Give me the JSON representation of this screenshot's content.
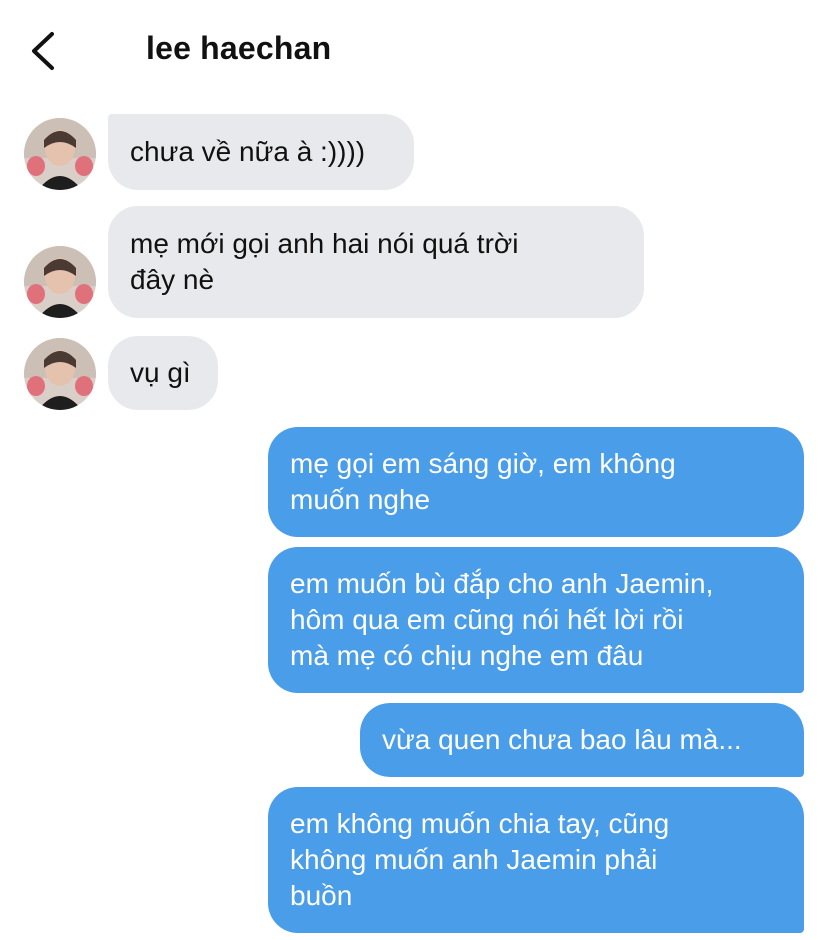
{
  "header": {
    "back_icon": "chevron-left-icon",
    "title": "lee haechan"
  },
  "messages": [
    {
      "direction": "incoming",
      "text": "chưa về nữa à :))))"
    },
    {
      "direction": "incoming",
      "text": "mẹ mới gọi anh hai nói quá trời\nđây nè"
    },
    {
      "direction": "incoming",
      "text": "vụ gì"
    },
    {
      "direction": "outgoing",
      "text": "mẹ gọi em sáng giờ, em không\nmuốn nghe"
    },
    {
      "direction": "outgoing",
      "text": "em muốn bù đắp cho anh Jaemin,\nhôm qua em cũng nói hết lời rồi\nmà mẹ có chịu nghe em đâu"
    },
    {
      "direction": "outgoing",
      "text": "vừa quen chưa bao lâu mà..."
    },
    {
      "direction": "outgoing",
      "text": "em không muốn chia tay, cũng\nkhông muốn anh Jaemin phải\nbuồn"
    }
  ],
  "colors": {
    "incoming_bubble": "#e7e9ec",
    "outgoing_bubble": "#4a9de8",
    "outgoing_text": "#ffffff",
    "incoming_text": "#111111"
  }
}
